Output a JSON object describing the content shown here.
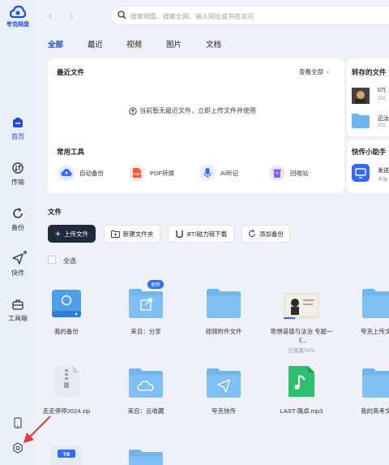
{
  "app": {
    "logo_text": "夸克网盘"
  },
  "nav": [
    {
      "label": "首页"
    },
    {
      "label": "传输"
    },
    {
      "label": "备份"
    },
    {
      "label": "快传"
    },
    {
      "label": "工具箱"
    }
  ],
  "search": {
    "placeholder": "搜索网盘、搜索全网、输入网址或书签访问"
  },
  "tabs": [
    "全部",
    "最近",
    "视频",
    "图片",
    "文档"
  ],
  "recent": {
    "title": "最近文件",
    "view_all": "查看全部",
    "empty_text": "当前暂无最近文件，立即上传文件并使用"
  },
  "tools": {
    "title": "常用工具",
    "items": [
      "自动备份",
      "PDF转换",
      "AI听记",
      "回收站"
    ]
  },
  "saved": {
    "title": "转存的文件",
    "items": [
      {
        "line1": "07(",
        "line2": "202"
      },
      {
        "line1": "迈汝",
        "line2": "202"
      }
    ]
  },
  "helper": {
    "title": "快传小助手",
    "line1": "发送",
    "line2": "多端"
  },
  "files_section": {
    "title": "文件",
    "buttons": [
      "上传文件",
      "新建文件夹",
      "BT/磁力链下载",
      "添加备份"
    ],
    "select_all": "全选",
    "badge": "更新"
  },
  "files": [
    {
      "name": "我的备份",
      "sub": ""
    },
    {
      "name": "来自：分享",
      "sub": ""
    },
    {
      "name": "视频附件文件",
      "sub": ""
    },
    {
      "name": "思想道德与法治 专题一《...",
      "sub": "已观看32%"
    },
    {
      "name": "夸克上传文",
      "sub": ""
    },
    {
      "name": "走走停停2024.zip",
      "sub": ""
    },
    {
      "name": "来自：云收藏",
      "sub": ""
    },
    {
      "name": "夸克快传",
      "sub": ""
    },
    {
      "name": "LAST-璐卓.mp3",
      "sub": ""
    },
    {
      "name": "我的高考文",
      "sub": ""
    }
  ],
  "colors": {
    "accent": "#1d4fd8",
    "folder": "#6fb6f0",
    "primary_button": "#1f2a3d",
    "annotation_arrow": "#e03a3a"
  }
}
